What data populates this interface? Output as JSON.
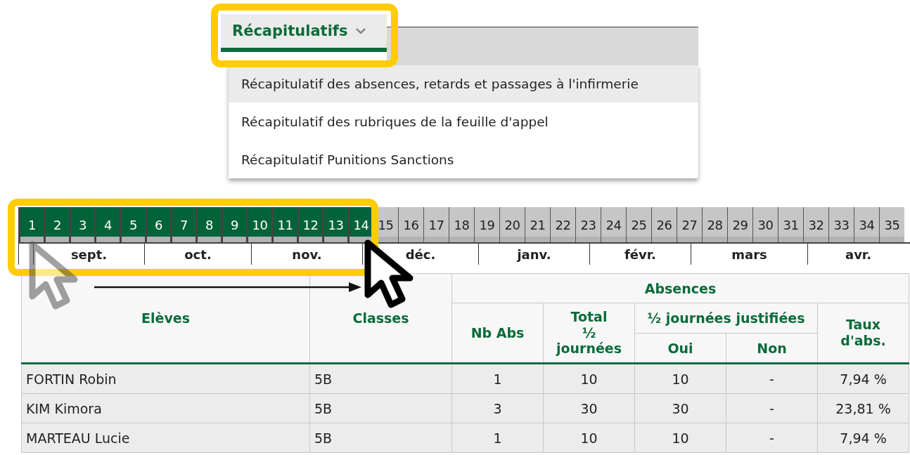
{
  "menu": {
    "tab": {
      "label": "Récapitulatifs",
      "expanded": true
    },
    "items": [
      {
        "label": "Récapitulatif des absences, retards et passages à l'infirmerie",
        "selected": true
      },
      {
        "label": "Récapitulatif des rubriques de la feuille d'appel",
        "selected": false
      },
      {
        "label": "Récapitulatif Punitions Sanctions",
        "selected": false
      }
    ]
  },
  "weeks": [
    {
      "label": "1",
      "selected": true
    },
    {
      "label": "2",
      "selected": true
    },
    {
      "label": "3",
      "selected": true
    },
    {
      "label": "4",
      "selected": true
    },
    {
      "label": "5",
      "selected": true
    },
    {
      "label": "6",
      "selected": true
    },
    {
      "label": "7",
      "selected": true
    },
    {
      "label": "8",
      "selected": true
    },
    {
      "label": "9",
      "selected": true
    },
    {
      "label": "10",
      "selected": true
    },
    {
      "label": "11",
      "selected": true
    },
    {
      "label": "12",
      "selected": true
    },
    {
      "label": "13",
      "selected": true
    },
    {
      "label": "14",
      "selected": true
    },
    {
      "label": "15",
      "selected": false
    },
    {
      "label": "16",
      "selected": false
    },
    {
      "label": "17",
      "selected": false
    },
    {
      "label": "18",
      "selected": false
    },
    {
      "label": "19",
      "selected": false
    },
    {
      "label": "20",
      "selected": false
    },
    {
      "label": "21",
      "selected": false
    },
    {
      "label": "22",
      "selected": false
    },
    {
      "label": "23",
      "selected": false
    },
    {
      "label": "24",
      "selected": false
    },
    {
      "label": "25",
      "selected": false
    },
    {
      "label": "26",
      "selected": false
    },
    {
      "label": "27",
      "selected": false
    },
    {
      "label": "28",
      "selected": false
    },
    {
      "label": "29",
      "selected": false
    },
    {
      "label": "30",
      "selected": false
    },
    {
      "label": "31",
      "selected": false
    },
    {
      "label": "32",
      "selected": false
    },
    {
      "label": "33",
      "selected": false
    },
    {
      "label": "34",
      "selected": false
    },
    {
      "label": "35",
      "selected": false
    }
  ],
  "months": [
    "sept.",
    "oct.",
    "nov.",
    "déc.",
    "janv.",
    "févr.",
    "mars",
    "avr."
  ],
  "table": {
    "headers": {
      "students": "Elèves",
      "classes": "Classes",
      "absences": "Absences",
      "nb_abs": "Nb Abs",
      "total": "Total ½ journées",
      "justified": "½ journées justifiées",
      "yes": "Oui",
      "no": "Non",
      "rate": "Taux d'abs."
    },
    "rows": [
      {
        "student": "FORTIN Robin",
        "class": "5B",
        "nb_abs": "1",
        "total": "10",
        "yes": "10",
        "no": "-",
        "rate": "7,94 %"
      },
      {
        "student": "KIM Kimora",
        "class": "5B",
        "nb_abs": "3",
        "total": "30",
        "yes": "30",
        "no": "-",
        "rate": "23,81 %"
      },
      {
        "student": "MARTEAU Lucie",
        "class": "5B",
        "nb_abs": "1",
        "total": "10",
        "yes": "10",
        "no": "-",
        "rate": "7,94 %"
      }
    ]
  }
}
